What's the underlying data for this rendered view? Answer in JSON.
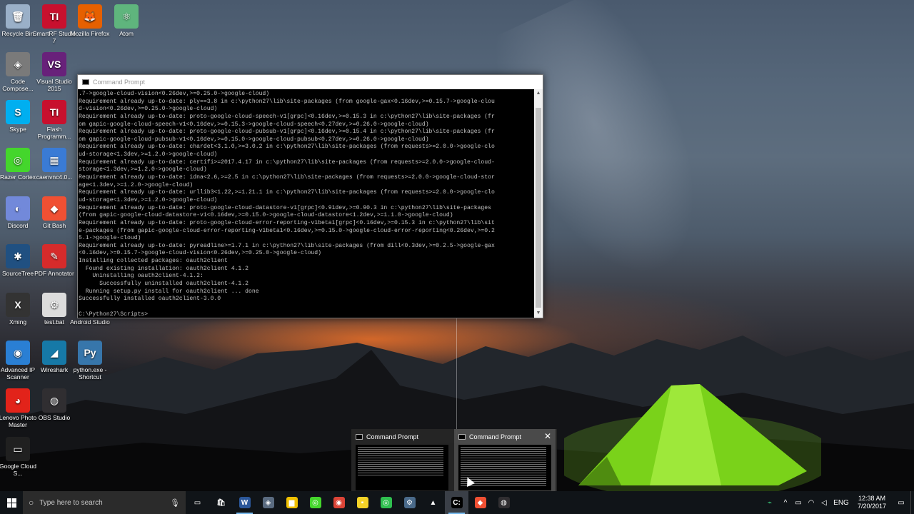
{
  "desktop": {
    "icons": [
      {
        "label": "Recycle Bin",
        "glyph": "recycle-bin-icon",
        "color": "#9ab0c8",
        "symbol": "🗑"
      },
      {
        "label": "SmartRF Studio 7",
        "glyph": "smartrf-icon",
        "color": "#c8102e",
        "symbol": "TI"
      },
      {
        "label": "Mozilla Firefox",
        "glyph": "firefox-icon",
        "color": "#e66000",
        "symbol": "🦊"
      },
      {
        "label": "Atom",
        "glyph": "atom-icon",
        "color": "#5fb57d",
        "symbol": "⚛"
      },
      {
        "label": "Code Compose...",
        "glyph": "code-composer-icon",
        "color": "#7a7a7a",
        "symbol": "◈"
      },
      {
        "label": "Visual Studio 2015",
        "glyph": "visual-studio-icon",
        "color": "#68217a",
        "symbol": "VS"
      },
      {
        "label": "Skype",
        "glyph": "skype-icon",
        "color": "#00aff0",
        "symbol": "S"
      },
      {
        "label": "Flash Programm...",
        "glyph": "flash-programmer-icon",
        "color": "#c8102e",
        "symbol": "TI"
      },
      {
        "label": "Razer Cortex",
        "glyph": "razer-cortex-icon",
        "color": "#44d62c",
        "symbol": "◎"
      },
      {
        "label": "caenvnc4.0...",
        "glyph": "caen-icon",
        "color": "#3a7bd5",
        "symbol": "▦"
      },
      {
        "label": "Discord",
        "glyph": "discord-icon",
        "color": "#7289da",
        "symbol": "◐"
      },
      {
        "label": "Git Bash",
        "glyph": "git-bash-icon",
        "color": "#f05033",
        "symbol": "◆"
      },
      {
        "label": "SourceTree",
        "glyph": "sourcetree-icon",
        "color": "#205081",
        "symbol": "✱"
      },
      {
        "label": "PDF Annotator",
        "glyph": "pdf-annotator-icon",
        "color": "#d62b2b",
        "symbol": "✎"
      },
      {
        "label": "Xming",
        "glyph": "xming-icon",
        "color": "#333333",
        "symbol": "X"
      },
      {
        "label": "test.bat",
        "glyph": "batch-file-icon",
        "color": "#dcdcdc",
        "symbol": "⚙"
      },
      {
        "label": "Android Studio",
        "glyph": "android-studio-icon",
        "color": "#3ddc84",
        "symbol": "A"
      },
      {
        "label": "Advanced IP Scanner",
        "glyph": "advanced-ip-scanner-icon",
        "color": "#2a7fd4",
        "symbol": "◉"
      },
      {
        "label": "Wireshark",
        "glyph": "wireshark-icon",
        "color": "#1679a7",
        "symbol": "◢"
      },
      {
        "label": "python.exe - Shortcut",
        "glyph": "python-icon",
        "color": "#3776ab",
        "symbol": "Py"
      },
      {
        "label": "Lenovo Photo Master",
        "glyph": "lenovo-photo-master-icon",
        "color": "#e2231a",
        "symbol": "◕"
      },
      {
        "label": "OBS Studio",
        "glyph": "obs-studio-icon",
        "color": "#302e31",
        "symbol": "◍"
      },
      {
        "label": "Google Cloud S...",
        "glyph": "google-cloud-sdk-icon",
        "color": "#202020",
        "symbol": "▭"
      }
    ]
  },
  "cmd_window": {
    "title": "Command Prompt",
    "lines": [
      ".7->google-cloud-vision<0.26dev,>=0.25.0->google-cloud)",
      "Requirement already up-to-date: ply==3.8 in c:\\python27\\lib\\site-packages (from google-gax<0.16dev,>=0.15.7->google-clou",
      "d-vision<0.26dev,>=0.25.0->google-cloud)",
      "Requirement already up-to-date: proto-google-cloud-speech-v1[grpc]<0.16dev,>=0.15.3 in c:\\python27\\lib\\site-packages (fr",
      "om gapic-google-cloud-speech-v1<0.16dev,>=0.15.3->google-cloud-speech<0.27dev,>=0.26.0->google-cloud)",
      "Requirement already up-to-date: proto-google-cloud-pubsub-v1[grpc]<0.16dev,>=0.15.4 in c:\\python27\\lib\\site-packages (fr",
      "om gapic-google-cloud-pubsub-v1<0.16dev,>=0.15.0->google-cloud-pubsub<0.27dev,>=0.26.0->google-cloud)",
      "Requirement already up-to-date: chardet<3.1.0,>=3.0.2 in c:\\python27\\lib\\site-packages (from requests>=2.0.0->google-clo",
      "ud-storage<1.3dev,>=1.2.0->google-cloud)",
      "Requirement already up-to-date: certifi>=2017.4.17 in c:\\python27\\lib\\site-packages (from requests>=2.0.0->google-cloud-",
      "storage<1.3dev,>=1.2.0->google-cloud)",
      "Requirement already up-to-date: idna<2.6,>=2.5 in c:\\python27\\lib\\site-packages (from requests>=2.0.0->google-cloud-stor",
      "age<1.3dev,>=1.2.0->google-cloud)",
      "Requirement already up-to-date: urllib3<1.22,>=1.21.1 in c:\\python27\\lib\\site-packages (from requests>=2.0.0->google-clo",
      "ud-storage<1.3dev,>=1.2.0->google-cloud)",
      "Requirement already up-to-date: proto-google-cloud-datastore-v1[grpc]<0.91dev,>=0.90.3 in c:\\python27\\lib\\site-packages",
      "(from gapic-google-cloud-datastore-v1<0.16dev,>=0.15.0->google-cloud-datastore<1.2dev,>=1.1.0->google-cloud)",
      "Requirement already up-to-date: proto-google-cloud-error-reporting-v1beta1[grpc]<0.16dev,>=0.15.3 in c:\\python27\\lib\\sit",
      "e-packages (from gapic-google-cloud-error-reporting-v1beta1<0.16dev,>=0.15.0->google-cloud-error-reporting<0.26dev,>=0.2",
      "5.1->google-cloud)",
      "Requirement already up-to-date: pyreadline>=1.7.1 in c:\\python27\\lib\\site-packages (from dill<0.3dev,>=0.2.5->google-gax",
      "<0.16dev,>=0.15.7->google-cloud-vision<0.26dev,>=0.25.0->google-cloud)",
      "Installing collected packages: oauth2client",
      "  Found existing installation: oauth2client 4.1.2",
      "    Uninstalling oauth2client-4.1.2:",
      "      Successfully uninstalled oauth2client-4.1.2",
      "  Running setup.py install for oauth2client ... done",
      "Successfully installed oauth2client-3.0.0",
      "",
      "C:\\Python27\\Scripts>"
    ]
  },
  "preview": {
    "items": [
      {
        "title": "Command Prompt"
      },
      {
        "title": "Command Prompt"
      }
    ],
    "close_symbol": "✕"
  },
  "taskbar": {
    "search_placeholder": "Type here to search",
    "apps": [
      {
        "name": "task-view",
        "symbol": "▭",
        "color": "#101418",
        "running": false
      },
      {
        "name": "store",
        "symbol": "🛍",
        "color": "#101418",
        "running": false
      },
      {
        "name": "word",
        "symbol": "W",
        "color": "#2b579a",
        "running": true
      },
      {
        "name": "unknown-app",
        "symbol": "◈",
        "color": "#5a6b80",
        "running": false
      },
      {
        "name": "file-explorer",
        "symbol": "▆",
        "color": "#f0c000",
        "running": false
      },
      {
        "name": "razer-cortex",
        "symbol": "◎",
        "color": "#44d62c",
        "running": false
      },
      {
        "name": "chrome",
        "symbol": "◉",
        "color": "#db4437",
        "running": false
      },
      {
        "name": "sticky-notes",
        "symbol": "▪",
        "color": "#f5d327",
        "running": false
      },
      {
        "name": "razer-synapse",
        "symbol": "◎",
        "color": "#2fbf4f",
        "running": false
      },
      {
        "name": "settings-tool",
        "symbol": "⚙",
        "color": "#4a6a8a",
        "running": false
      },
      {
        "name": "photos",
        "symbol": "▲",
        "color": "#101418",
        "running": false
      },
      {
        "name": "command-prompt",
        "symbol": "C:",
        "color": "#000000",
        "running": true,
        "active": true
      },
      {
        "name": "git-bash",
        "symbol": "◆",
        "color": "#f05033",
        "running": false
      },
      {
        "name": "obs-studio",
        "symbol": "◍",
        "color": "#302e31",
        "running": false
      }
    ],
    "tray": {
      "language": "ENG",
      "time": "12:38 AM",
      "date": "7/20/2017"
    }
  }
}
